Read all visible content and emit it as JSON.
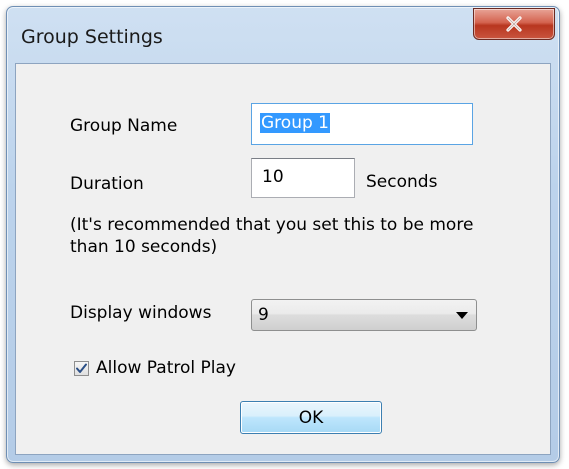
{
  "window": {
    "title": "Group Settings",
    "close_label": "X"
  },
  "form": {
    "group_name_label": "Group Name",
    "group_name_value": "Group 1",
    "duration_label": "Duration",
    "duration_value": "10",
    "duration_unit": "Seconds",
    "recommendation_line1": "(It's recommended that you set this to be more",
    "recommendation_line2": "than 10 seconds)",
    "display_windows_label": "Display windows",
    "display_windows_value": "9",
    "allow_patrol_label": "Allow Patrol Play",
    "allow_patrol_checked": true,
    "ok_label": "OK"
  },
  "colors": {
    "selection": "#3399ff",
    "close_button": "#c9553f",
    "title_bar": "#bcd3ec"
  }
}
